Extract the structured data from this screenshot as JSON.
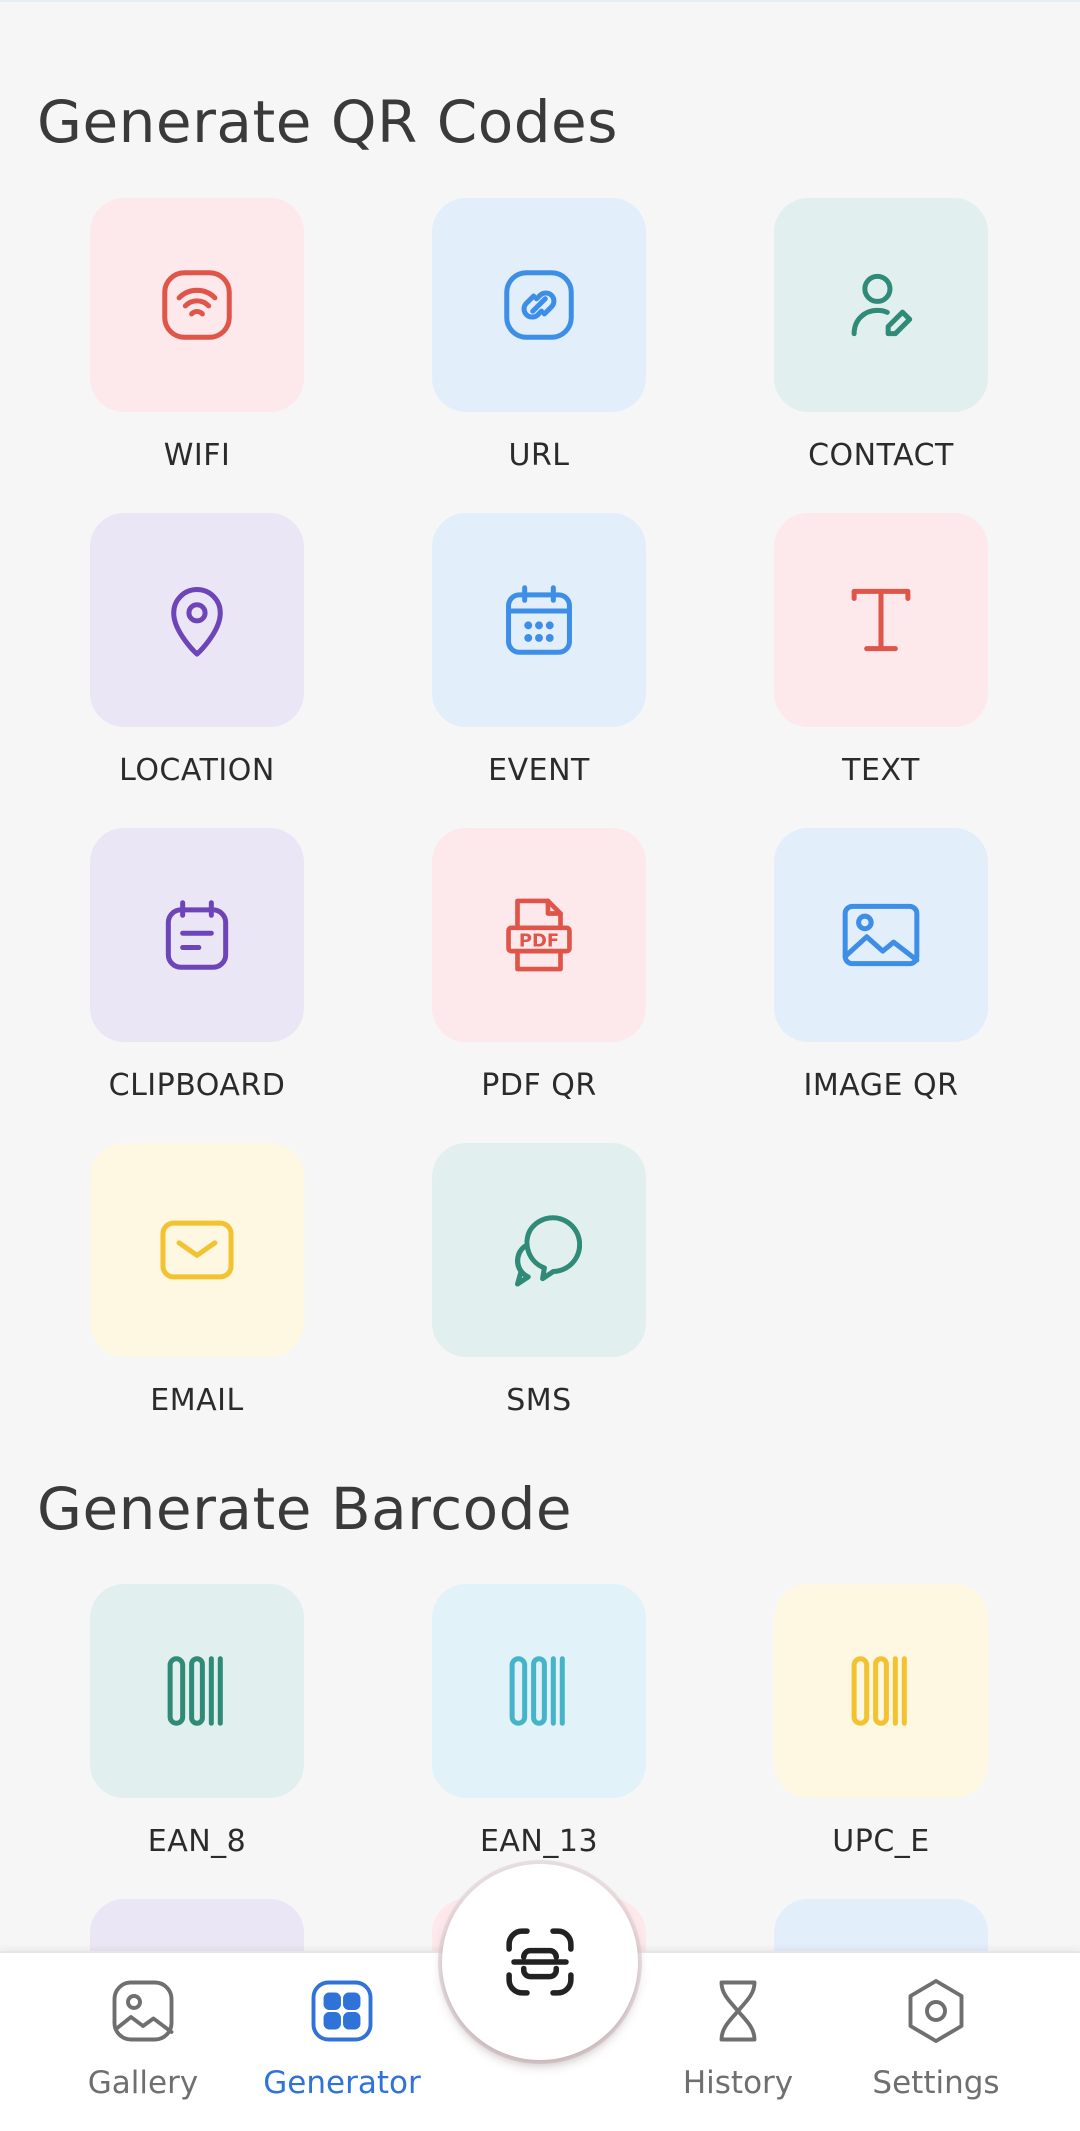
{
  "qr_section": {
    "title": "Generate QR Codes",
    "items": [
      {
        "label": "WIFI",
        "icon": "wifi-icon",
        "bg": "#fde8ec",
        "color": "#df5648"
      },
      {
        "label": "URL",
        "icon": "link-icon",
        "bg": "#e3eefb",
        "color": "#3d8ee6"
      },
      {
        "label": "CONTACT",
        "icon": "user-edit-icon",
        "bg": "#e1f0ee",
        "color": "#2f8b78"
      },
      {
        "label": "LOCATION",
        "icon": "map-pin-icon",
        "bg": "#ebe6f5",
        "color": "#6d45b8"
      },
      {
        "label": "EVENT",
        "icon": "calendar-icon",
        "bg": "#e3eefb",
        "color": "#3d8ee6"
      },
      {
        "label": "TEXT",
        "icon": "text-icon",
        "bg": "#fde8ec",
        "color": "#df5648"
      },
      {
        "label": "CLIPBOARD",
        "icon": "clipboard-icon",
        "bg": "#ebe6f5",
        "color": "#6d45b8"
      },
      {
        "label": "PDF QR",
        "icon": "pdf-icon",
        "bg": "#fde8ec",
        "color": "#df5648"
      },
      {
        "label": "IMAGE QR",
        "icon": "image-icon",
        "bg": "#e3eefb",
        "color": "#3d8ee6"
      },
      {
        "label": "EMAIL",
        "icon": "email-icon",
        "bg": "#fef7e1",
        "color": "#f2c230"
      },
      {
        "label": "SMS",
        "icon": "chat-icon",
        "bg": "#e1f0ee",
        "color": "#2f8b78"
      }
    ]
  },
  "barcode_section": {
    "title": "Generate Barcode",
    "items": [
      {
        "label": "EAN_8",
        "icon": "barcode-icon",
        "bg": "#e1f0ee",
        "color": "#2f8b78"
      },
      {
        "label": "EAN_13",
        "icon": "barcode-icon",
        "bg": "#e1f3f8",
        "color": "#45b3c8"
      },
      {
        "label": "UPC_E",
        "icon": "barcode-icon",
        "bg": "#fef7e1",
        "color": "#f2c230"
      }
    ],
    "partial_row_bgs": [
      "#ebe6f5",
      "#fde8ec",
      "#e3eefb"
    ]
  },
  "bottom_nav": {
    "items": [
      {
        "label": "Gallery",
        "icon": "gallery-icon",
        "active": false
      },
      {
        "label": "Generator",
        "icon": "generator-grid-icon",
        "active": true
      },
      {
        "label": "History",
        "icon": "hourglass-icon",
        "active": false
      },
      {
        "label": "Settings",
        "icon": "settings-icon",
        "active": false
      }
    ],
    "scan_button_icon": "scan-icon"
  },
  "colors": {
    "background": "#f6f6f7",
    "active_nav": "#2f73d9",
    "inactive_nav": "#6f6f6f"
  }
}
